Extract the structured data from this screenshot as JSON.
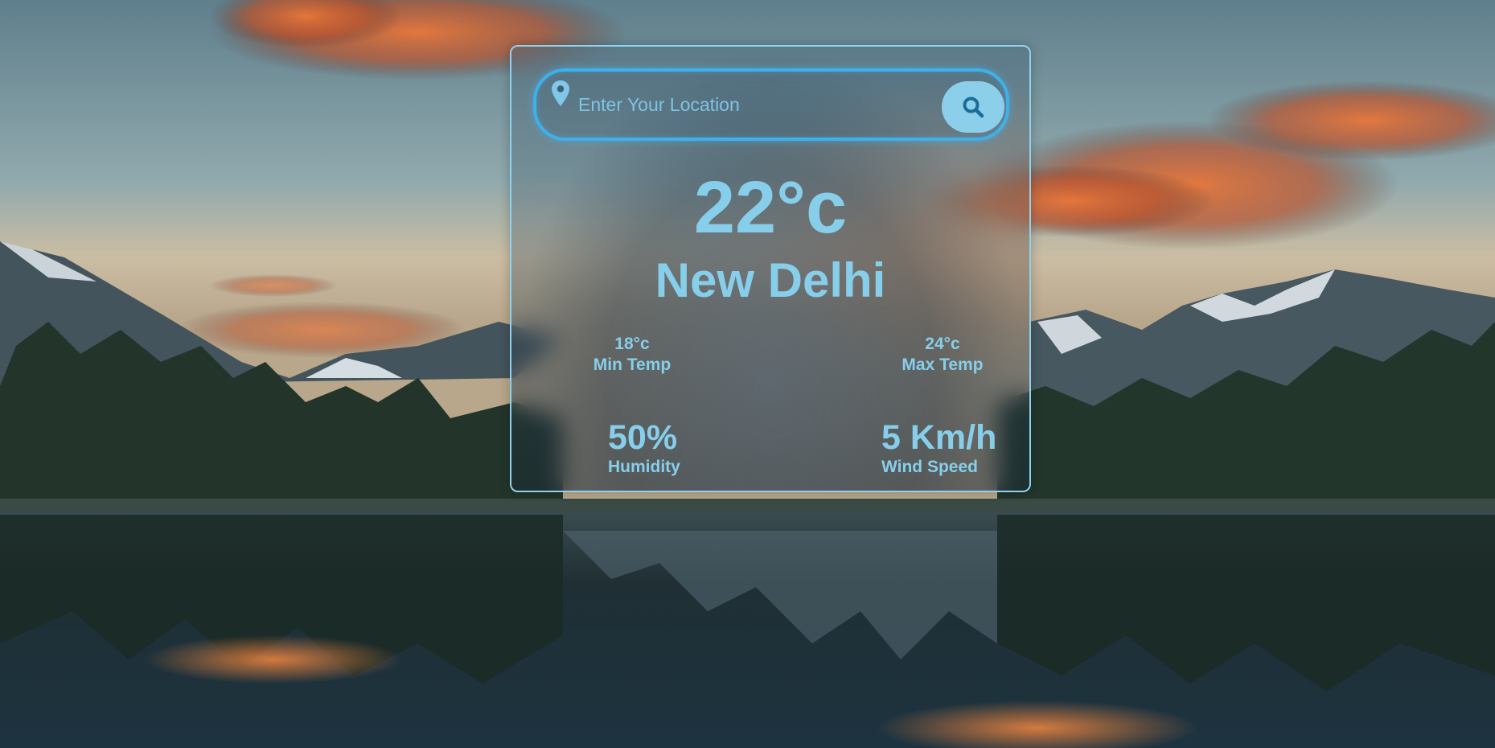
{
  "search": {
    "placeholder": "Enter Your Location",
    "value": ""
  },
  "weather": {
    "temperature": "22°c",
    "city": "New Delhi",
    "min_temp_value": "18°c",
    "min_temp_label": "Min Temp",
    "max_temp_value": "24°c",
    "max_temp_label": "Max Temp",
    "humidity_value": "50%",
    "humidity_label": "Humidity",
    "wind_value": "5 Km/h",
    "wind_label": "Wind Speed"
  },
  "icons": {
    "location": "map-pin-icon",
    "search": "magnifier-icon"
  },
  "colors": {
    "accent": "#87ceeb",
    "search_border": "#3fb1ea",
    "button_bg": "#8ccfeb",
    "button_icon": "#1b6d97"
  }
}
